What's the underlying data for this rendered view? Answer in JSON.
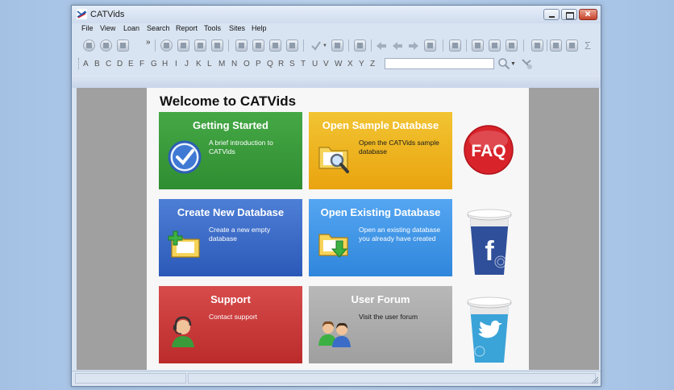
{
  "window": {
    "title": "CATVids"
  },
  "menu": [
    "File",
    "View",
    "Loan",
    "Search",
    "Report",
    "Tools",
    "Sites",
    "Help"
  ],
  "alphabet": [
    "A",
    "B",
    "C",
    "D",
    "E",
    "F",
    "G",
    "H",
    "I",
    "J",
    "K",
    "L",
    "M",
    "N",
    "O",
    "P",
    "Q",
    "R",
    "S",
    "T",
    "U",
    "V",
    "W",
    "X",
    "Y",
    "Z"
  ],
  "search": {
    "value": "",
    "placeholder": ""
  },
  "welcome": {
    "title": "Welcome to CATVids"
  },
  "tiles": [
    {
      "title": "Getting Started",
      "desc": "A brief introduction to CATVids"
    },
    {
      "title": "Open Sample Database",
      "desc": "Open the CATVids sample database"
    },
    {
      "title": "Create New Database",
      "desc": "Create a new empty database"
    },
    {
      "title": "Open Existing Database",
      "desc": "Open an existing database you already have created"
    },
    {
      "title": "Support",
      "desc": "Contact support"
    },
    {
      "title": "User Forum",
      "desc": "Visit the user forum"
    }
  ],
  "side": {
    "faq_label": "FAQ",
    "facebook_label": "f"
  },
  "colors": {
    "green": "#3a9c3c",
    "yellow": "#efb51f",
    "blue": "#3a6cc8",
    "light_blue": "#44a0ee",
    "red": "#cc3a3a",
    "gray": "#ababab",
    "faq_red": "#d8232a"
  }
}
